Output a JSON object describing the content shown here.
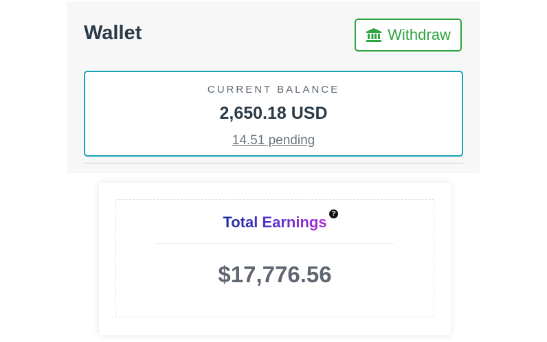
{
  "wallet": {
    "title": "Wallet",
    "withdraw_label": "Withdraw",
    "balance_label": "CURRENT BALANCE",
    "balance_amount": "2,650.18 USD",
    "pending": "14.51 pending",
    "colors": {
      "accent_green": "#2fa33f",
      "card_border": "#1aa3b4",
      "text_dark": "#2b3a47"
    },
    "icons": {
      "withdraw": "bank-icon"
    }
  },
  "earnings": {
    "title": "Total Earnings",
    "help": "?",
    "value": "$17,776.56",
    "icons": {
      "help": "question-circle-icon"
    }
  }
}
